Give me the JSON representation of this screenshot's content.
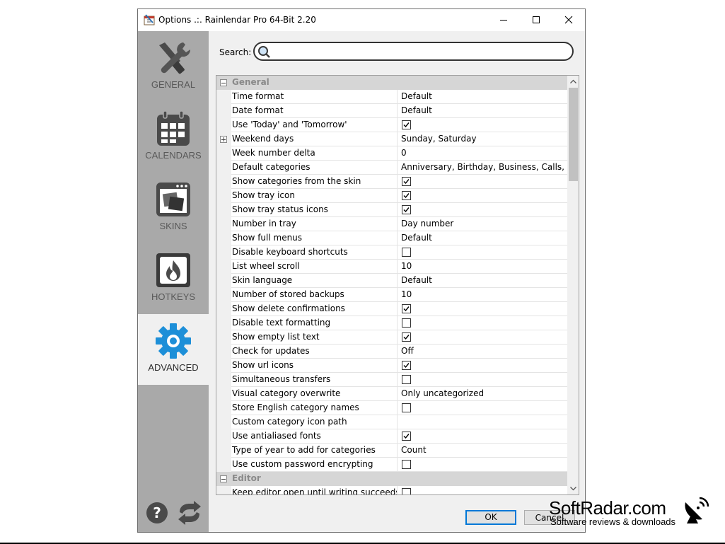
{
  "window": {
    "title": "Options .:. Rainlendar Pro 64-Bit 2.20"
  },
  "sidebar": {
    "items": [
      {
        "label": "GENERAL",
        "icon": "tools-icon"
      },
      {
        "label": "CALENDARS",
        "icon": "calendar-icon"
      },
      {
        "label": "SKINS",
        "icon": "skins-icon"
      },
      {
        "label": "HOTKEYS",
        "icon": "hotkeys-icon"
      },
      {
        "label": "ADVANCED",
        "icon": "gear-icon",
        "active": true
      }
    ]
  },
  "search": {
    "label": "Search:",
    "value": "",
    "placeholder": ""
  },
  "grid": {
    "general_category": "General",
    "rows": [
      {
        "name": "Time format",
        "value": "Default"
      },
      {
        "name": "Date format",
        "value": "Default"
      },
      {
        "name": "Use 'Today' and 'Tomorrow'",
        "checkbox": true,
        "checked": true
      },
      {
        "name": "Weekend days",
        "value": "Sunday, Saturday",
        "expandable": true
      },
      {
        "name": "Week number delta",
        "value": "0"
      },
      {
        "name": "Default categories",
        "value": "Anniversary, Birthday, Business, Calls, Clients"
      },
      {
        "name": "Show categories from the skin",
        "checkbox": true,
        "checked": true
      },
      {
        "name": "Show tray icon",
        "checkbox": true,
        "checked": true
      },
      {
        "name": "Show tray status icons",
        "checkbox": true,
        "checked": true
      },
      {
        "name": "Number in tray",
        "value": "Day number"
      },
      {
        "name": "Show full menus",
        "value": "Default"
      },
      {
        "name": "Disable keyboard shortcuts",
        "checkbox": true,
        "checked": false
      },
      {
        "name": "List wheel scroll",
        "value": "10"
      },
      {
        "name": "Skin language",
        "value": "Default"
      },
      {
        "name": "Number of stored backups",
        "value": "10"
      },
      {
        "name": "Show delete confirmations",
        "checkbox": true,
        "checked": true
      },
      {
        "name": "Disable text formatting",
        "checkbox": true,
        "checked": false
      },
      {
        "name": "Show empty list text",
        "checkbox": true,
        "checked": true
      },
      {
        "name": "Check for updates",
        "value": "Off"
      },
      {
        "name": "Show url icons",
        "checkbox": true,
        "checked": true
      },
      {
        "name": "Simultaneous transfers",
        "checkbox": true,
        "checked": false
      },
      {
        "name": "Visual category overwrite",
        "value": "Only uncategorized"
      },
      {
        "name": "Store English category names",
        "checkbox": true,
        "checked": false
      },
      {
        "name": "Custom category icon path",
        "value": ""
      },
      {
        "name": "Use antialiased fonts",
        "checkbox": true,
        "checked": true
      },
      {
        "name": "Type of year to add for categories",
        "value": "Count"
      },
      {
        "name": "Use custom password encrypting",
        "checkbox": true,
        "checked": false
      }
    ],
    "editor_category": "Editor",
    "editor_rows": [
      {
        "name": "Keep editor open until writing succeeds",
        "checkbox": true,
        "checked": false
      }
    ]
  },
  "buttons": {
    "ok": "OK",
    "cancel": "Cancel"
  },
  "watermark": {
    "title": "SoftRadar.com",
    "subtitle": "Software reviews & downloads"
  },
  "colors": {
    "accent": "#1d8fd8",
    "sidebar_bg": "#a9a9a9",
    "category_bg": "#d6d6d6"
  }
}
